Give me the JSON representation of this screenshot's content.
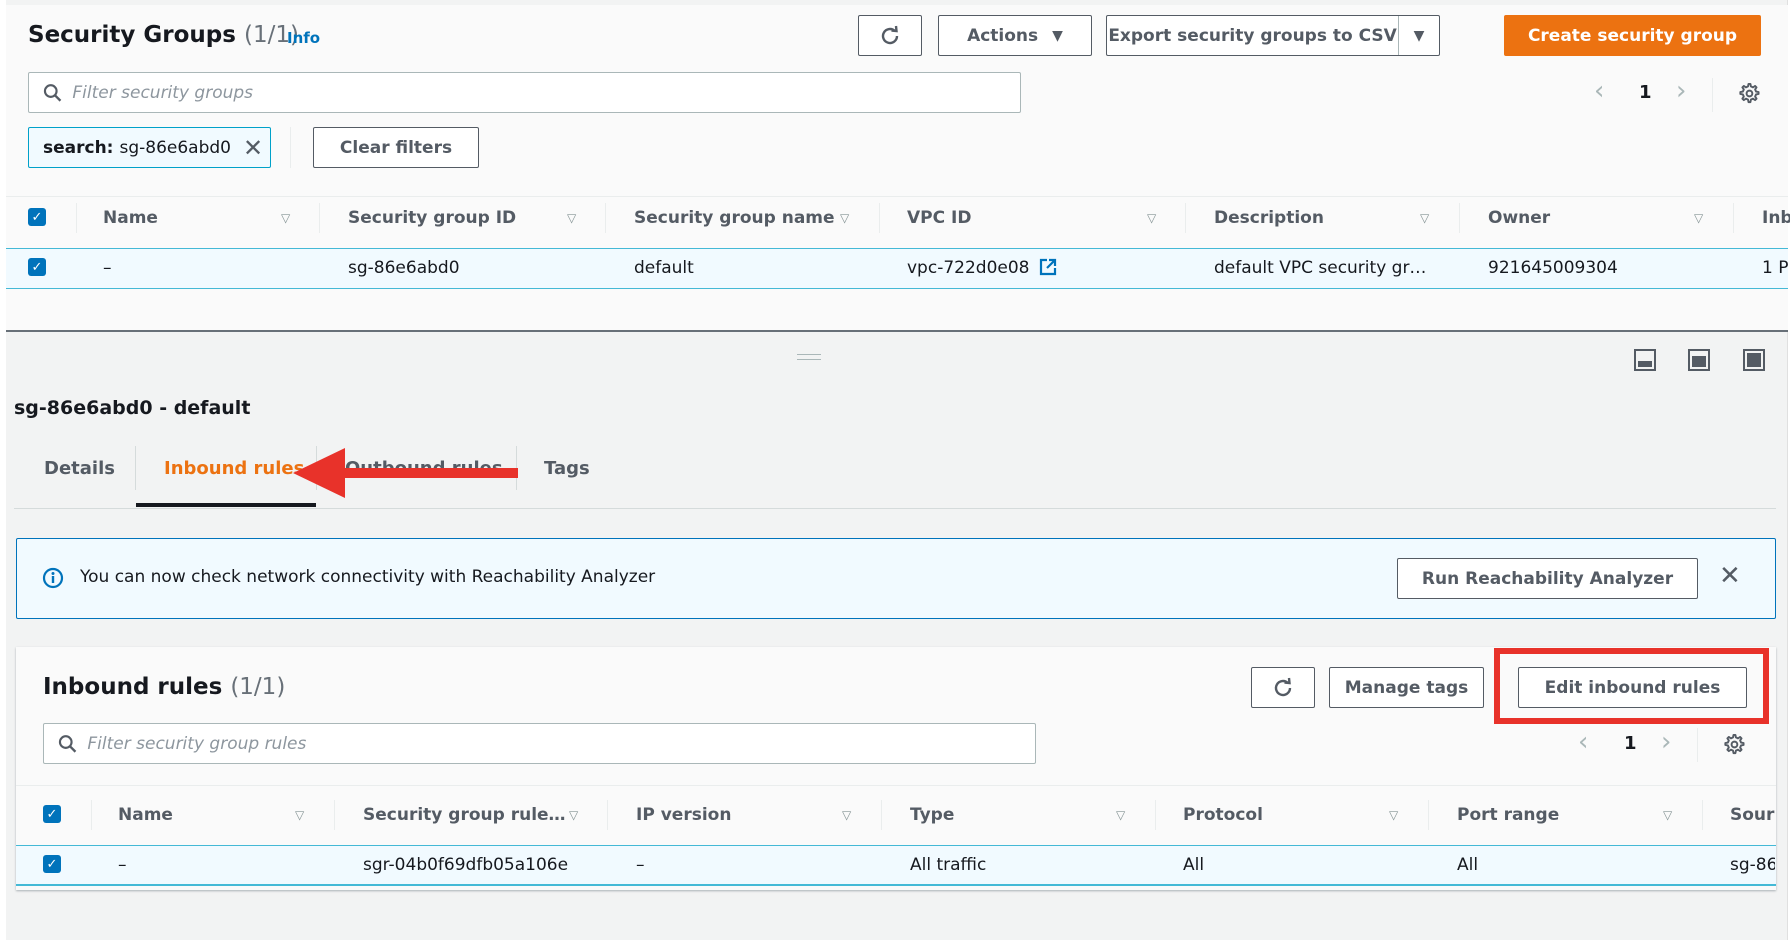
{
  "header": {
    "title": "Security Groups",
    "count": "(1/1)",
    "info_link": "Info",
    "refresh_icon": "refresh-icon",
    "actions_label": "Actions",
    "export_label": "Export security groups to CSV",
    "create_label": "Create security group",
    "accent_color": "#ec7211"
  },
  "filter": {
    "placeholder": "Filter security groups",
    "chip_key": "search:",
    "chip_value": "sg-86e6abd0",
    "clear_label": "Clear filters"
  },
  "pagination": {
    "current_page": "1"
  },
  "groups_table": {
    "columns": [
      "Name",
      "Security group ID",
      "Security group name",
      "VPC ID",
      "Description",
      "Owner",
      "Inb"
    ],
    "rows": [
      {
        "selected": true,
        "name": "–",
        "security_group_id": "sg-86e6abd0",
        "security_group_name": "default",
        "vpc_id": "vpc-722d0e08",
        "description": "default VPC security gr…",
        "owner": "921645009304",
        "inbound": "1 P"
      }
    ]
  },
  "details": {
    "title": "sg-86e6abd0 - default",
    "tabs": [
      {
        "label": "Details",
        "active": false
      },
      {
        "label": "Inbound rules",
        "active": true
      },
      {
        "label": "Outbound rules",
        "active": false
      },
      {
        "label": "Tags",
        "active": false
      }
    ]
  },
  "info_banner": {
    "message": "You can now check network connectivity with Reachability Analyzer",
    "button_label": "Run Reachability Analyzer"
  },
  "inbound": {
    "title": "Inbound rules",
    "count": "(1/1)",
    "manage_tags_label": "Manage tags",
    "edit_label": "Edit inbound rules",
    "filter_placeholder": "Filter security group rules",
    "current_page": "1",
    "columns": [
      "Name",
      "Security group rule…",
      "IP version",
      "Type",
      "Protocol",
      "Port range",
      "Sour"
    ],
    "rows": [
      {
        "selected": true,
        "name": "–",
        "rule_id": "sgr-04b0f69dfb05a106e",
        "ip_version": "–",
        "type": "All traffic",
        "protocol": "All",
        "port_range": "All",
        "source": "sg-86"
      }
    ]
  },
  "annotations": {
    "arrow_color": "#e8322a",
    "highlight_color": "#e8322a"
  }
}
